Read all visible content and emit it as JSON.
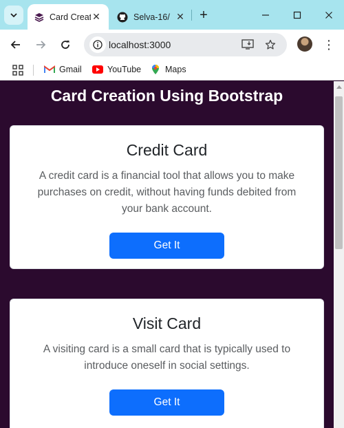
{
  "browser": {
    "tabs": [
      {
        "title": "Card Creation Using Bootstrap",
        "favicon": "bootstrap-stack-icon",
        "active": true
      },
      {
        "title": "Selva-16/",
        "favicon": "github-icon",
        "active": false
      }
    ],
    "address": "localhost:3000",
    "bookmarks": [
      {
        "label": "Gmail",
        "icon": "gmail-icon"
      },
      {
        "label": "YouTube",
        "icon": "youtube-icon"
      },
      {
        "label": "Maps",
        "icon": "maps-icon"
      }
    ]
  },
  "page": {
    "title": "Card Creation Using Bootstrap",
    "cards": [
      {
        "title": "Credit Card",
        "text": "A credit card is a financial tool that allows you to make purchases on credit, without having funds debited from your bank account.",
        "button": "Get It"
      },
      {
        "title": "Visit Card",
        "text": "A visiting card is a small card that is typically used to introduce oneself in social settings.",
        "button": "Get It"
      }
    ]
  },
  "colors": {
    "page_background": "#2b0a2e",
    "button": "#0d6efd",
    "tabstrip": "#a7e4ee"
  }
}
